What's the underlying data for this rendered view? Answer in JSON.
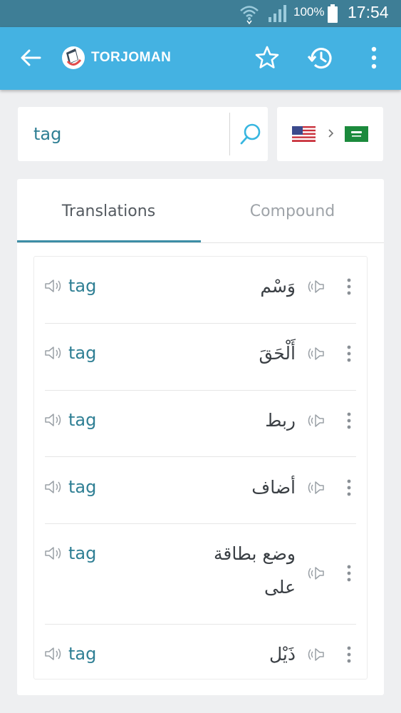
{
  "status_bar": {
    "battery_percent": "100%",
    "time": "17:54"
  },
  "app_bar": {
    "title": "TORJOMAN",
    "color": "#44b2e2"
  },
  "search": {
    "query": "tag"
  },
  "language_pair": {
    "source_flag": "us-flag-icon",
    "target_flag": "saudi-flag-icon"
  },
  "tabs": [
    {
      "label": "Translations",
      "active": true
    },
    {
      "label": "Compound",
      "active": false
    }
  ],
  "results": [
    {
      "source": "tag",
      "target": "وَسْم"
    },
    {
      "source": "tag",
      "target": "أَلْحَقَ"
    },
    {
      "source": "tag",
      "target": "ربط"
    },
    {
      "source": "tag",
      "target": "أضاف"
    },
    {
      "source": "tag",
      "target": "وضع بطاقة على"
    },
    {
      "source": "tag",
      "target": "ذَيْل"
    }
  ],
  "colors": {
    "accent": "#44b2e2",
    "status_bar": "#3e7e96",
    "source_text": "#2f7f94",
    "tab_indicator": "#3d8ea6"
  }
}
